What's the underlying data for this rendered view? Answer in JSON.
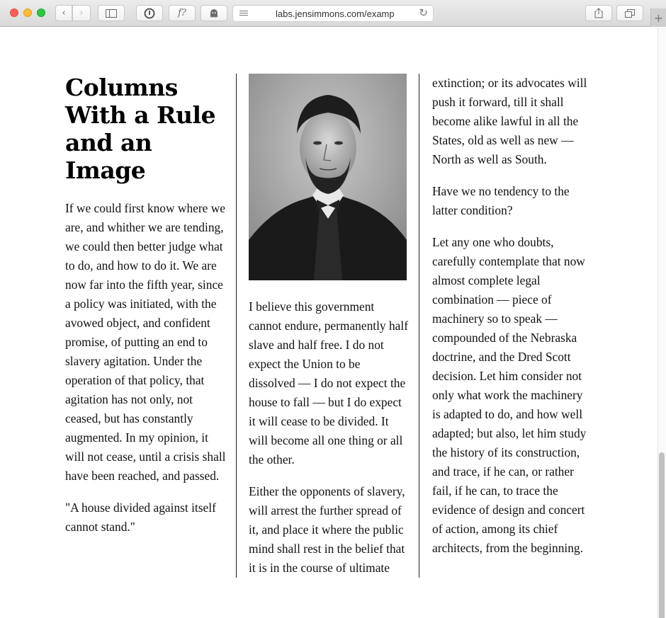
{
  "browser": {
    "url": "labs.jensimmons.com/examp",
    "reader_glyph": "f?",
    "new_tab_glyph": "+"
  },
  "article": {
    "title": "Columns With a Rule and an Image",
    "col1": {
      "p1": "If we could first know where we are, and whither we are tending, we could then better judge what to do, and how to do it. We are now far into the fifth year, since a policy was initiated, with the avowed object, and confident promise, of putting an end to slavery agitation. Under the operation of that policy, that agitation has not only, not ceased, but has constantly augmented. In my opinion, it will not cease, until a crisis shall have been reached, and passed.",
      "p2": "\"A house divided against itself cannot stand.\""
    },
    "col2": {
      "p1": "I believe this government cannot endure, permanently half slave and half free. I do not expect the Union to be dissolved — I do not expect the house to fall — but I do expect it will cease to be divided. It will become all one thing or all the other.",
      "p2": "Either the opponents of slavery, will arrest the further spread of it, and place it where the public mind shall rest in the belief that it is in the course of ultimate"
    },
    "col3": {
      "p1": "extinction; or its advocates will push it forward, till it shall become alike lawful in all the States, old as well as new — North as well as South.",
      "p2": "Have we no tendency to the latter condition?",
      "p3": "Let any one who doubts, carefully contemplate that now almost complete legal combination — piece of machinery so to speak — compounded of the Nebraska doctrine, and the Dred Scott decision. Let him consider not only what work the machinery is adapted to do, and how well adapted; but also, let him study the history of its construction, and trace, if he can, or rather fail, if he can, to trace the evidence of design and concert of action, among its chief architects, from the beginning."
    }
  },
  "colors": {
    "text": "#111111",
    "rule": "#222222"
  }
}
